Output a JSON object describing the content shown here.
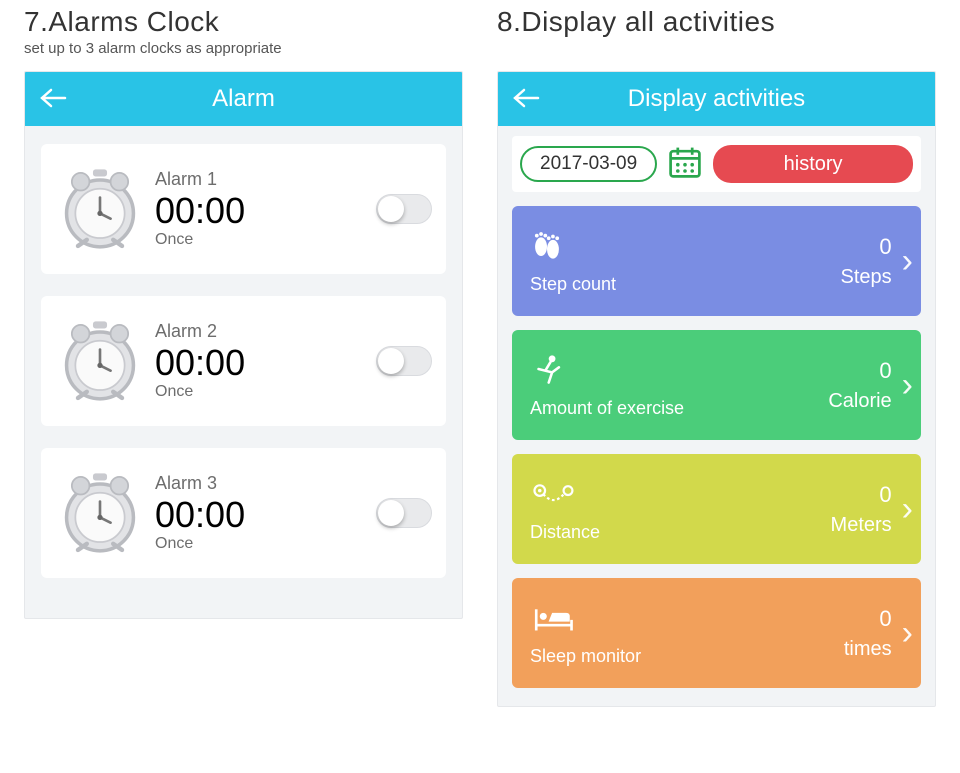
{
  "sections": {
    "alarm": {
      "num": "7.",
      "title": "Alarms Clock",
      "sub": "set up to 3 alarm clocks as appropriate"
    },
    "activities": {
      "num": "8.",
      "title": "Display all activities"
    }
  },
  "alarm_screen": {
    "title": "Alarm",
    "items": [
      {
        "name": "Alarm 1",
        "time": "00:00",
        "repeat": "Once"
      },
      {
        "name": "Alarm 2",
        "time": "00:00",
        "repeat": "Once"
      },
      {
        "name": "Alarm 3",
        "time": "00:00",
        "repeat": "Once"
      }
    ]
  },
  "activities_screen": {
    "title": "Display activities",
    "date": "2017-03-09",
    "history_label": "history",
    "cards": [
      {
        "label": "Step count",
        "value": "0",
        "unit": "Steps"
      },
      {
        "label": "Amount of exercise",
        "value": "0",
        "unit": "Calorie"
      },
      {
        "label": "Distance",
        "value": "0",
        "unit": "Meters"
      },
      {
        "label": "Sleep monitor",
        "value": "0",
        "unit": "times"
      }
    ]
  }
}
